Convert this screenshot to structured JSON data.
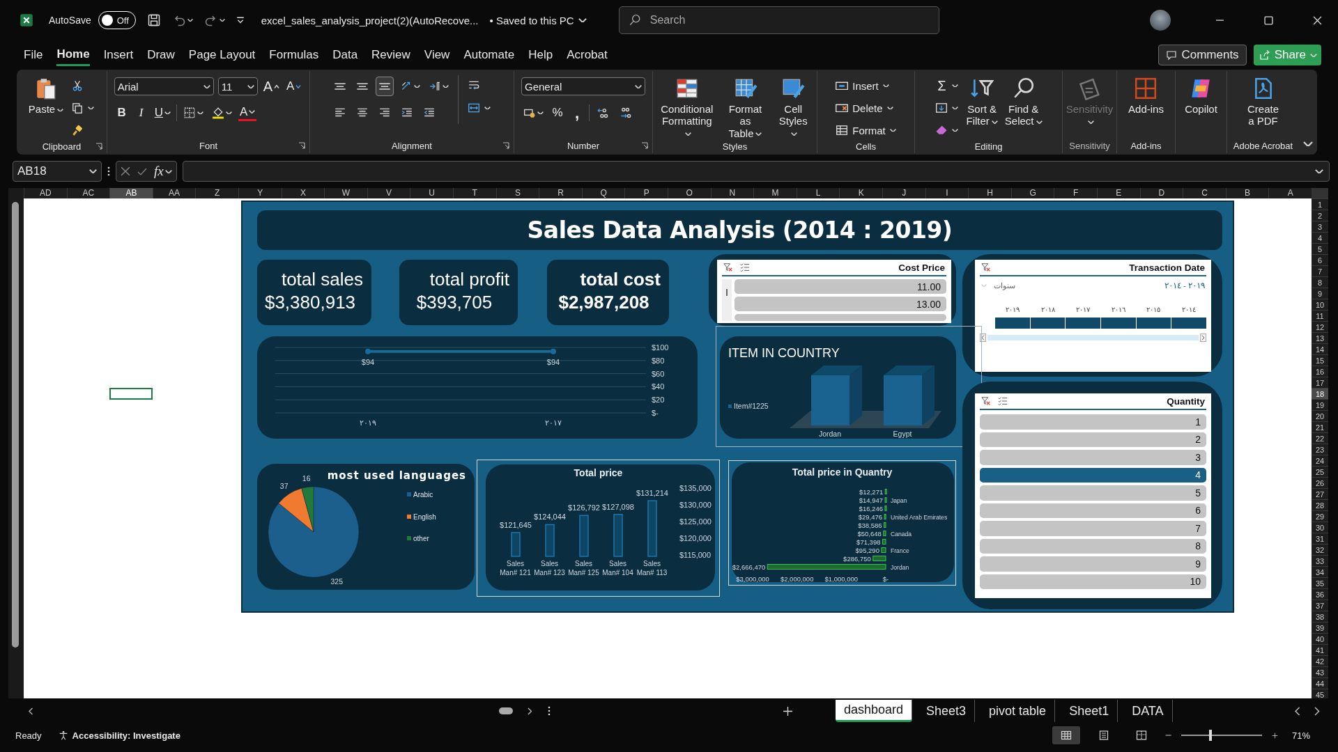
{
  "title_bar": {
    "autosave_label": "AutoSave",
    "autosave": {
      "on": false,
      "label": "Off"
    },
    "quick_access": [
      {
        "kind": "save"
      },
      {
        "kind": "undo"
      },
      {
        "kind": "redo"
      },
      {
        "kind": "customize"
      }
    ],
    "document_title": "excel_sales_analysis_project(2)(AutoRecove...",
    "save_status": "• Saved to this PC",
    "search": {
      "placeholder": "Search"
    }
  },
  "menu_tabs": [
    {
      "label": "File",
      "selected": false
    },
    {
      "label": "Home",
      "selected": true
    },
    {
      "label": "Insert",
      "selected": false
    },
    {
      "label": "Draw",
      "selected": false
    },
    {
      "label": "Page Layout",
      "selected": false
    },
    {
      "label": "Formulas",
      "selected": false
    },
    {
      "label": "Data",
      "selected": false
    },
    {
      "label": "Review",
      "selected": false
    },
    {
      "label": "View",
      "selected": false
    },
    {
      "label": "Automate",
      "selected": false
    },
    {
      "label": "Help",
      "selected": false
    },
    {
      "label": "Acrobat",
      "selected": false
    }
  ],
  "comments_button": "Comments",
  "share_button": "Share",
  "ribbon": [
    {
      "kind": "clipboard",
      "label": "Clipboard",
      "paste": "Paste"
    },
    {
      "kind": "font",
      "label": "Font",
      "font": "Arial",
      "size": "11",
      "grow": "A",
      "shrink": "A",
      "bold": {
        "text": "B",
        "on": false
      },
      "italic": {
        "text": "I",
        "on": false
      },
      "underline": {
        "text": "U",
        "on": false
      },
      "font_color": "A"
    },
    {
      "kind": "alignment",
      "label": "Alignment",
      "vertical": [
        {
          "selected": false
        },
        {
          "selected": false
        },
        {
          "selected": true
        }
      ],
      "horizontal": [
        {
          "selected": false
        },
        {
          "selected": false
        },
        {
          "selected": false
        }
      ]
    },
    {
      "kind": "number",
      "label": "Number",
      "format": "General",
      "percent": "%",
      "comma": ","
    },
    {
      "kind": "styles",
      "label": "Styles",
      "buttons": [
        "Conditional\nFormatting",
        "Format as\nTable",
        "Cell\nStyles"
      ]
    },
    {
      "kind": "cells",
      "label": "Cells",
      "buttons": [
        "Insert",
        "Delete",
        "Format"
      ]
    },
    {
      "kind": "editing",
      "label": "Editing",
      "sum": "Σ",
      "buttons": [
        "Sort &\nFilter",
        "Find &\nSelect"
      ]
    },
    {
      "kind": "single",
      "label": "Sensitivity",
      "button": "Sensitivity",
      "disabled": true
    },
    {
      "kind": "single",
      "label": "Add-ins",
      "button": "Add-ins",
      "disabled": false
    },
    {
      "kind": "single",
      "button": "Copilot",
      "disabled": false
    },
    {
      "kind": "single",
      "label": "Adobe Acrobat",
      "button": "Create\na PDF",
      "disabled": false
    }
  ],
  "formula_bar": {
    "name_box": "AB18",
    "function_label": "fx"
  },
  "sheet": {
    "columns": [
      {
        "label": "AD",
        "selected": false
      },
      {
        "label": "AC",
        "selected": false
      },
      {
        "label": "AB",
        "selected": true
      },
      {
        "label": "AA",
        "selected": false
      },
      {
        "label": "Z",
        "selected": false
      },
      {
        "label": "Y",
        "selected": false
      },
      {
        "label": "X",
        "selected": false
      },
      {
        "label": "W",
        "selected": false
      },
      {
        "label": "V",
        "selected": false
      },
      {
        "label": "U",
        "selected": false
      },
      {
        "label": "T",
        "selected": false
      },
      {
        "label": "S",
        "selected": false
      },
      {
        "label": "R",
        "selected": false
      },
      {
        "label": "Q",
        "selected": false
      },
      {
        "label": "P",
        "selected": false
      },
      {
        "label": "O",
        "selected": false
      },
      {
        "label": "N",
        "selected": false
      },
      {
        "label": "M",
        "selected": false
      },
      {
        "label": "L",
        "selected": false
      },
      {
        "label": "K",
        "selected": false
      },
      {
        "label": "J",
        "selected": false
      },
      {
        "label": "I",
        "selected": false
      },
      {
        "label": "H",
        "selected": false
      },
      {
        "label": "G",
        "selected": false
      },
      {
        "label": "F",
        "selected": false
      },
      {
        "label": "E",
        "selected": false
      },
      {
        "label": "D",
        "selected": false
      },
      {
        "label": "C",
        "selected": false
      },
      {
        "label": "B",
        "selected": false
      },
      {
        "label": "A",
        "selected": false
      }
    ],
    "rows": [
      {
        "label": "1",
        "selected": false
      },
      {
        "label": "2",
        "selected": false
      },
      {
        "label": "3",
        "selected": false
      },
      {
        "label": "4",
        "selected": false
      },
      {
        "label": "5",
        "selected": false
      },
      {
        "label": "6",
        "selected": false
      },
      {
        "label": "7",
        "selected": false
      },
      {
        "label": "8",
        "selected": false
      },
      {
        "label": "9",
        "selected": false
      },
      {
        "label": "10",
        "selected": false
      },
      {
        "label": "11",
        "selected": false
      },
      {
        "label": "12",
        "selected": false
      },
      {
        "label": "13",
        "selected": false
      },
      {
        "label": "14",
        "selected": false
      },
      {
        "label": "15",
        "selected": false
      },
      {
        "label": "16",
        "selected": false
      },
      {
        "label": "17",
        "selected": false
      },
      {
        "label": "18",
        "selected": true
      },
      {
        "label": "19",
        "selected": false
      },
      {
        "label": "20",
        "selected": false
      },
      {
        "label": "21",
        "selected": false
      },
      {
        "label": "22",
        "selected": false
      },
      {
        "label": "23",
        "selected": false
      },
      {
        "label": "24",
        "selected": false
      },
      {
        "label": "25",
        "selected": false
      },
      {
        "label": "26",
        "selected": false
      },
      {
        "label": "27",
        "selected": false
      },
      {
        "label": "28",
        "selected": false
      },
      {
        "label": "29",
        "selected": false
      },
      {
        "label": "30",
        "selected": false
      },
      {
        "label": "31",
        "selected": false
      },
      {
        "label": "32",
        "selected": false
      },
      {
        "label": "33",
        "selected": false
      },
      {
        "label": "34",
        "selected": false
      },
      {
        "label": "35",
        "selected": false
      },
      {
        "label": "36",
        "selected": false
      },
      {
        "label": "37",
        "selected": false
      },
      {
        "label": "38",
        "selected": false
      },
      {
        "label": "39",
        "selected": false
      },
      {
        "label": "40",
        "selected": false
      },
      {
        "label": "41",
        "selected": false
      },
      {
        "label": "42",
        "selected": false
      },
      {
        "label": "43",
        "selected": false
      },
      {
        "label": "44",
        "selected": false
      },
      {
        "label": "45",
        "selected": false
      }
    ]
  },
  "dashboard": {
    "title": "Sales Data Analysis (2014 : 2019)",
    "kpis": [
      {
        "label": "total sales",
        "value": "$3,380,913",
        "bold": false
      },
      {
        "label": "total profit",
        "value": "$393,705",
        "bold": false
      },
      {
        "label": "total cost",
        "value": "$2,987,208",
        "bold": true
      }
    ],
    "trend_chart": {
      "chart_data": {
        "type": "line",
        "categories": [
          "٢٠١٩",
          "٢٠١٧"
        ],
        "values": [
          94,
          94
        ],
        "value_labels": [
          "$94",
          "$94"
        ],
        "grid": true,
        "marker": true,
        "ylim": [
          0,
          100
        ],
        "yticks": [
          {
            "value": 0,
            "label": "$-"
          },
          {
            "value": 20,
            "label": "$20"
          },
          {
            "value": 40,
            "label": "$40"
          },
          {
            "value": 60,
            "label": "$60"
          },
          {
            "value": 80,
            "label": "$80"
          },
          {
            "value": 100,
            "label": "$100"
          }
        ]
      }
    },
    "cost_price_slicer": {
      "title": "Cost Price",
      "items": [
        {
          "label": "11.00",
          "selected": false
        },
        {
          "label": "13.00",
          "selected": false
        }
      ]
    },
    "transaction_timeline": {
      "title": "Transaction Date",
      "period_label": "سنوات",
      "range": "٢٠١٩ - ٢٠١٤",
      "years": [
        {
          "label": "٢٠١٤",
          "selected": true
        },
        {
          "label": "٢٠١٥",
          "selected": true
        },
        {
          "label": "٢٠١٦",
          "selected": true
        },
        {
          "label": "٢٠١٧",
          "selected": true
        },
        {
          "label": "٢٠١٨",
          "selected": true
        },
        {
          "label": "٢٠١٩",
          "selected": true
        }
      ]
    },
    "item_in_country": {
      "title": "ITEM IN COUNTRY",
      "legend": "Item#1225",
      "categories": [
        "Jordan",
        "Egypt"
      ]
    },
    "quantity_slicer": {
      "title": "Quantity",
      "items": [
        {
          "label": "1",
          "selected": false
        },
        {
          "label": "2",
          "selected": false
        },
        {
          "label": "3",
          "selected": false
        },
        {
          "label": "4",
          "selected": true
        },
        {
          "label": "5",
          "selected": false
        },
        {
          "label": "6",
          "selected": false
        },
        {
          "label": "7",
          "selected": false
        },
        {
          "label": "8",
          "selected": false
        },
        {
          "label": "9",
          "selected": false
        },
        {
          "label": "10",
          "selected": false
        }
      ]
    },
    "languages_chart": {
      "chart_data": {
        "type": "pie",
        "title": "most used languages",
        "categories": [
          "Arabic",
          "English",
          "other"
        ],
        "values": [
          325,
          37,
          16
        ],
        "data_labels": true,
        "legend": "right"
      }
    },
    "total_price_chart": {
      "chart_data": {
        "type": "bar",
        "title": "Total price",
        "categories": [
          "Sales Man# 121",
          "Sales Man# 123",
          "Sales Man# 125",
          "Sales Man# 104",
          "Sales Man# 113"
        ],
        "values": [
          121645,
          124044,
          126792,
          127098,
          131214
        ],
        "value_labels": [
          "$121,645",
          "$124,044",
          "$126,792",
          "$127,098",
          "$131,214"
        ],
        "ylim": [
          114500,
          135000
        ],
        "yticks": [
          {
            "value": 115000,
            "label": "$115,000"
          },
          {
            "value": 120000,
            "label": "$120,000"
          },
          {
            "value": 125000,
            "label": "$125,000"
          },
          {
            "value": 130000,
            "label": "$130,000"
          },
          {
            "value": 135000,
            "label": "$135,000"
          }
        ]
      }
    },
    "price_by_country_chart": {
      "chart_data": {
        "type": "bar",
        "orientation": "horizontal",
        "title": "Total price in Quantry",
        "categories": [
          null,
          "Japan",
          null,
          "United Arab Emirates",
          null,
          "Canada",
          null,
          "France",
          null,
          "Jordan"
        ],
        "values": [
          12271,
          14947,
          16246,
          29476,
          38586,
          50648,
          71398,
          95290,
          286750,
          2666470
        ],
        "value_labels": [
          "$12,271",
          "$14,947",
          "$16,246",
          "$29,476",
          "$38,586",
          "$50,648",
          "$71,398",
          "$95,290",
          "$286,750",
          "$2,666,470"
        ],
        "xlim": [
          3000000,
          0
        ],
        "xticks": [
          {
            "value": 3000000,
            "label": "$3,000,000"
          },
          {
            "value": 2000000,
            "label": "$2,000,000"
          },
          {
            "value": 1000000,
            "label": "$1,000,000"
          },
          {
            "value": 0,
            "label": "$-"
          }
        ]
      }
    }
  },
  "sheet_tabs": [
    {
      "label": "dashboard",
      "selected": true
    },
    {
      "label": "Sheet3",
      "selected": false
    },
    {
      "label": "pivot table",
      "selected": false
    },
    {
      "label": "Sheet1",
      "selected": false
    },
    {
      "label": "DATA",
      "selected": false
    }
  ],
  "status_bar": {
    "ready": "Ready",
    "accessibility": "Accessibility: Investigate",
    "views": [
      {
        "kind": "normal",
        "selected": true
      },
      {
        "kind": "page-layout",
        "selected": false
      },
      {
        "kind": "page-break",
        "selected": false
      }
    ],
    "zoom": {
      "level": 0.36,
      "label": "71%"
    }
  }
}
